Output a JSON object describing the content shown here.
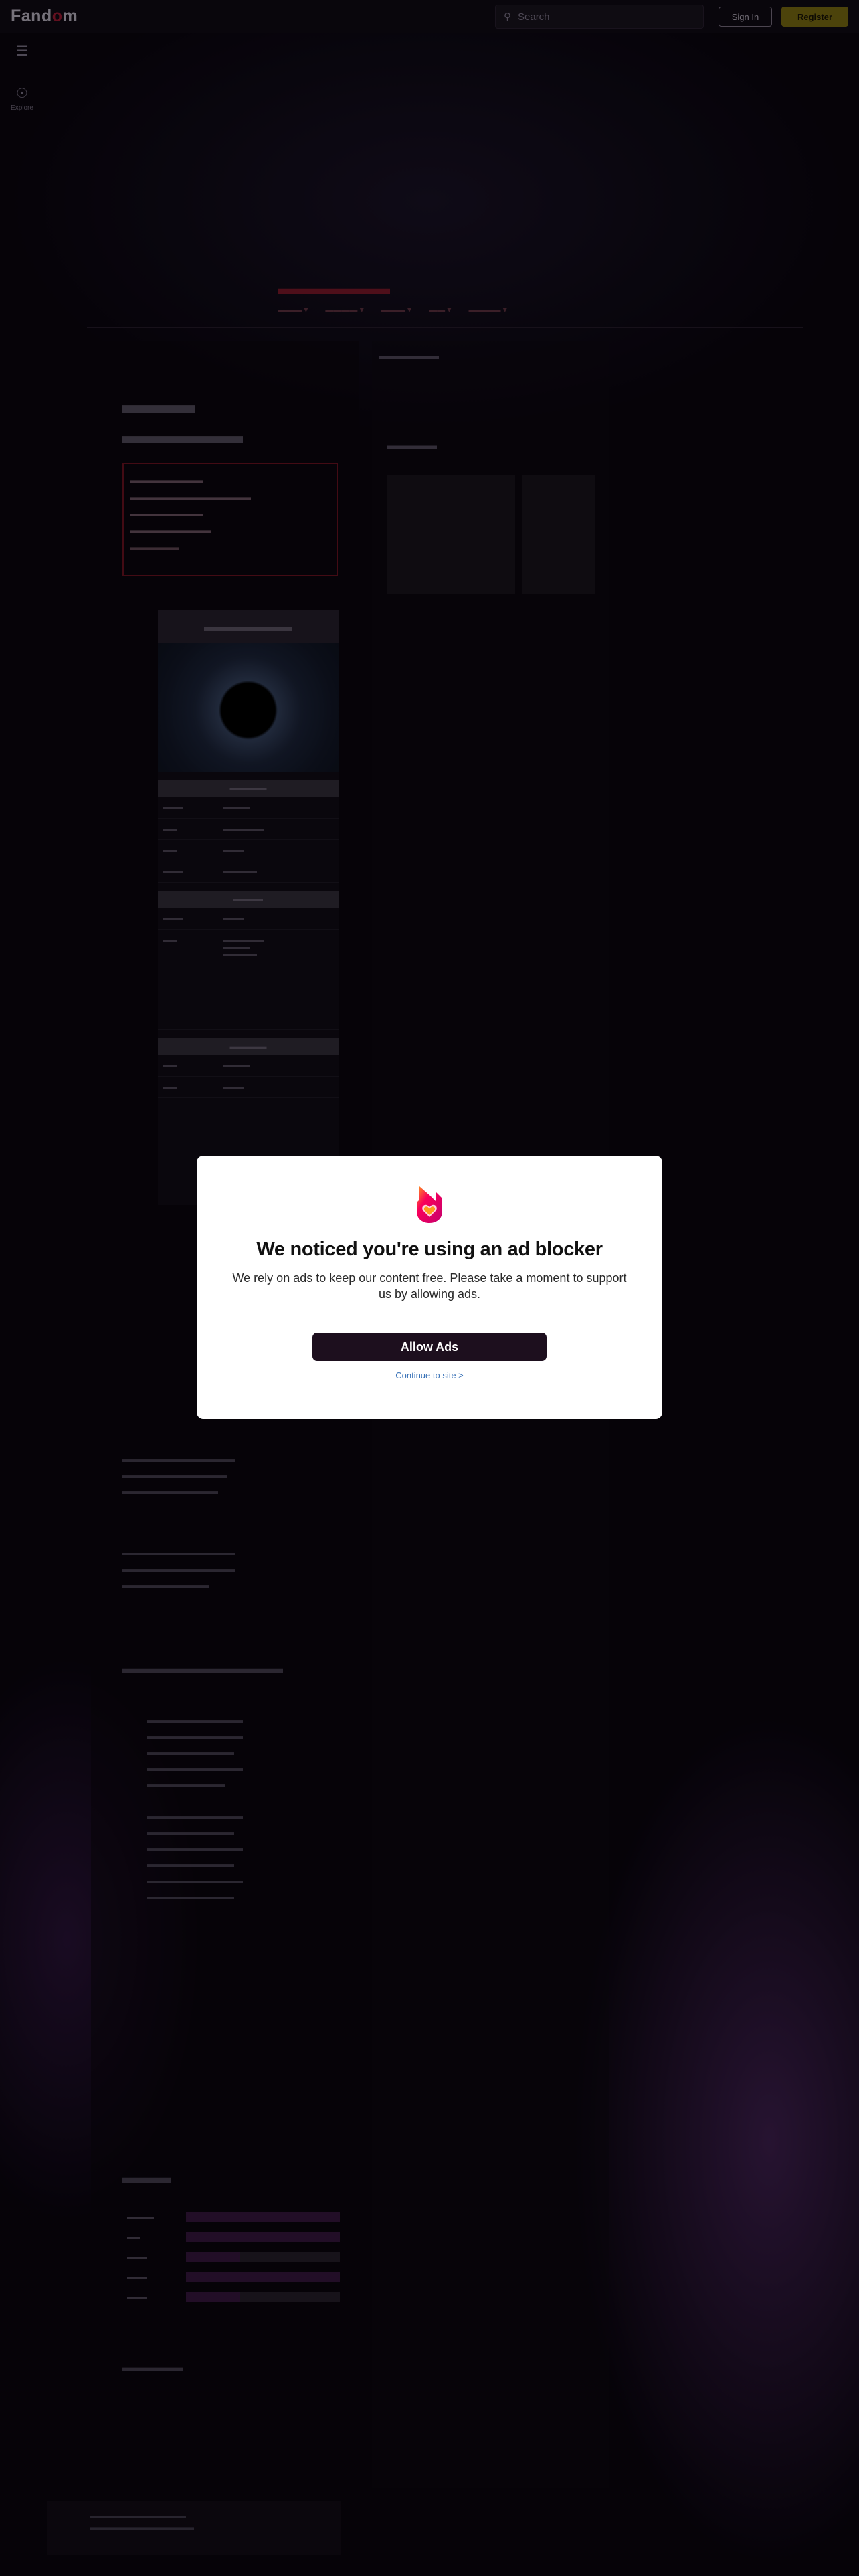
{
  "header": {
    "logo_prefix": "Fand",
    "logo_o": "o",
    "logo_suffix": "m",
    "search_placeholder": "Search",
    "signin_label": "Sign In",
    "register_label": "Register",
    "explore_label": "Explore"
  },
  "modal": {
    "title": "We noticed you're using an ad blocker",
    "body": "We rely on ads to keep our content free. Please take a moment to support us by allowing ads.",
    "allow_label": "Allow Ads",
    "continue_label": "Continue to site >"
  },
  "colors": {
    "brand_magenta": "#fa005a",
    "brand_orange": "#ff9c1a",
    "button_dark": "#1d0f1e",
    "link_blue": "#3a73b8"
  }
}
